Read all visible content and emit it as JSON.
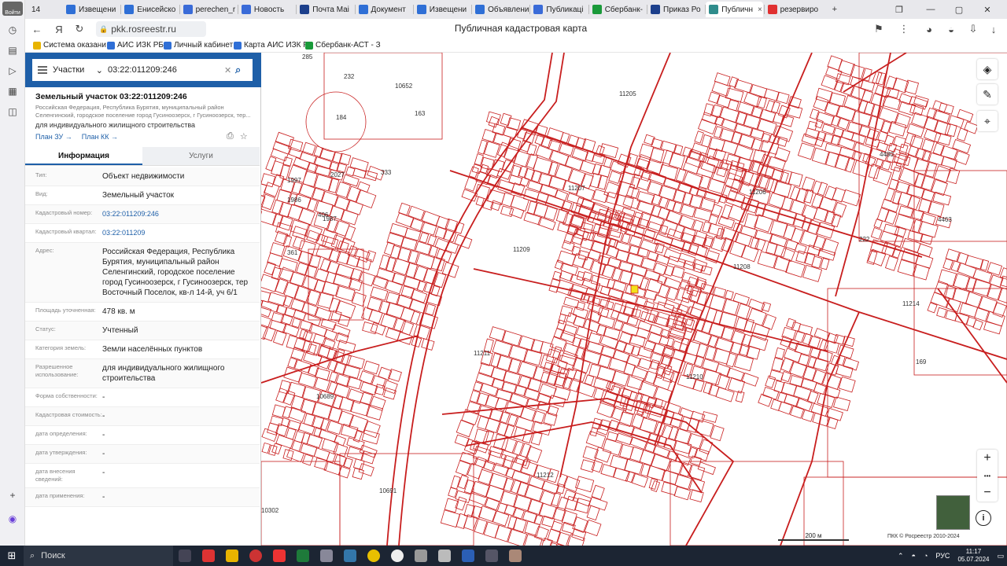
{
  "browser": {
    "tab_count": "14",
    "tabs": [
      {
        "label": "Извещени",
        "color": "#2f6fd6"
      },
      {
        "label": "Енисейско",
        "color": "#2f6fd6"
      },
      {
        "label": "perechen_r",
        "color": "#3a6bd8"
      },
      {
        "label": "Новость",
        "color": "#3a6bd8"
      },
      {
        "label": "Почта Mai",
        "color": "#1c3f8c"
      },
      {
        "label": "Документ",
        "color": "#2f6fd6"
      },
      {
        "label": "Извещени",
        "color": "#2f6fd6"
      },
      {
        "label": "Объявлени",
        "color": "#2f6fd6"
      },
      {
        "label": "Публикаці",
        "color": "#3a6bd8"
      },
      {
        "label": "Сбербанк-",
        "color": "#1a9a3a"
      },
      {
        "label": "Приказ Ро",
        "color": "#1c3f8c"
      },
      {
        "label": "Публичн",
        "color": "#2f8c8c"
      },
      {
        "label": "резервиро",
        "color": "#e03030"
      }
    ],
    "active_tab_index": 11,
    "close_label": "×",
    "new_tab_label": "+",
    "url": "pkk.rosreestr.ru",
    "page_title": "Публичная кадастровая карта",
    "bookmarks": [
      {
        "label": "Система оказани",
        "color": "#e8b400"
      },
      {
        "label": "АИС ИЗК РБ",
        "color": "#2f6fd6"
      },
      {
        "label": "Личный кабинет",
        "color": "#2f6fd6"
      },
      {
        "label": "Карта АИС ИЗК Р",
        "color": "#2f6fd6"
      },
      {
        "label": "Сбербанк-АСТ - З",
        "color": "#1a9a3a"
      }
    ],
    "sidebar_avatar_label": "Войти"
  },
  "panel": {
    "search": {
      "type_label": "Участки",
      "value": "03:22:011209:246"
    },
    "object": {
      "title": "Земельный участок 03:22:011209:246",
      "address_short": "Российская Федерация, Республика Бурятия, муниципальный район Селенгинский, городское поселение город Гусиноозерск, г Гусиноозерск, тер...",
      "purpose": "для индивидуального жилищного строительства",
      "plan_zu": "План ЗУ →",
      "plan_kk": "План КК →"
    },
    "tabs": {
      "info": "Информация",
      "services": "Услуги"
    },
    "props": [
      {
        "k": "Тип:",
        "v": "Объект недвижимости",
        "link": false
      },
      {
        "k": "Вид:",
        "v": "Земельный участок",
        "link": false
      },
      {
        "k": "Кадастровый номер:",
        "v": "03:22:011209:246",
        "link": true
      },
      {
        "k": "Кадастровый квартал:",
        "v": "03:22:011209",
        "link": true
      },
      {
        "k": "Адрес:",
        "v": "Российская Федерация, Республика Бурятия, муниципальный район Селенгинский, городское поселение город Гусиноозерск, г Гусиноозерск, тер Восточный Поселок, кв-л 14-й, уч 6/1",
        "link": false
      },
      {
        "k": "Площадь уточненная:",
        "v": "478 кв. м",
        "link": false
      },
      {
        "k": "Статус:",
        "v": "Учтенный",
        "link": false
      },
      {
        "k": "Категория земель:",
        "v": "Земли населённых пунктов",
        "link": false
      },
      {
        "k": "Разрешенное использование:",
        "v": "для индивидуального жилищного строительства",
        "link": false
      },
      {
        "k": "Форма собственности:",
        "v": "-",
        "link": false
      },
      {
        "k": "Кадастровая стоимость:",
        "v": "-",
        "link": false
      },
      {
        "k": "дата определения:",
        "v": "-",
        "link": false
      },
      {
        "k": "дата утверждения:",
        "v": "-",
        "link": false
      },
      {
        "k": "дата внесения сведений:",
        "v": "-",
        "link": false
      },
      {
        "k": "дата применения:",
        "v": "-",
        "link": false
      }
    ]
  },
  "map": {
    "quarter_labels": [
      "11205",
      "11207",
      "11206",
      "11209",
      "11208",
      "11214",
      "11211",
      "11210",
      "11212",
      "10691",
      "10689",
      "10652",
      "10302",
      "4480",
      "4463",
      "222",
      "169",
      "163",
      "184",
      "361",
      "1986",
      "1987",
      "333",
      "1997",
      "2027",
      "406",
      "232",
      "285"
    ],
    "scale_label": "200 м",
    "copyright": "ПКК © Росреестр 2010-2024",
    "stroke_color": "#c81e1e",
    "highlight_color": "#f2e21a",
    "zoom_in": "+",
    "zoom_more": "•••",
    "zoom_out": "−",
    "info_label": "i"
  },
  "taskbar": {
    "search_label": "Поиск",
    "lang": "РУС",
    "time": "11:17",
    "date": "05.07.2024"
  }
}
